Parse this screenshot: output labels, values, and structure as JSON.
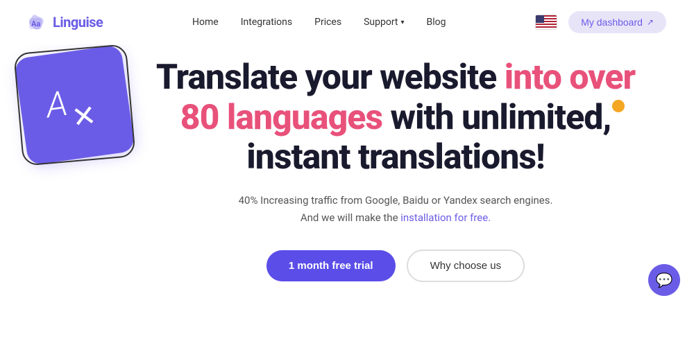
{
  "brand": {
    "name": "Linguise",
    "icon_label": "linguise-logo-icon"
  },
  "nav": {
    "links": [
      {
        "label": "Home",
        "id": "home",
        "has_dropdown": false
      },
      {
        "label": "Integrations",
        "id": "integrations",
        "has_dropdown": false
      },
      {
        "label": "Prices",
        "id": "prices",
        "has_dropdown": false
      },
      {
        "label": "Support",
        "id": "support",
        "has_dropdown": true
      },
      {
        "label": "Blog",
        "id": "blog",
        "has_dropdown": false
      }
    ],
    "language_icon": "flag-us-icon",
    "dashboard_button": "My dashboard"
  },
  "hero": {
    "title_part1": "Translate your website ",
    "title_highlight": "into over 80 languages",
    "title_part2": " with unlimited, instant translations!",
    "subtitle_line1": "40% Increasing traffic from Google, Baidu or Yandex search engines.",
    "subtitle_line2_prefix": "And we will make the ",
    "subtitle_link": "installation for free.",
    "cta_primary": "1 month free trial",
    "cta_secondary": "Why choose us"
  },
  "chat": {
    "icon_label": "chat-bubble-icon"
  },
  "colors": {
    "brand_purple": "#6b5ce7",
    "highlight_pink": "#e8517a",
    "orange_accent": "#f5a623"
  }
}
